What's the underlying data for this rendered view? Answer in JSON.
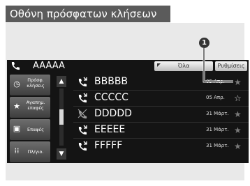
{
  "title": "Οθόνη πρόσφατων κλήσεων",
  "topbar": {
    "contact": "AAAAA",
    "all_label": "Όλα",
    "settings_label": "Ρυθμίσεις"
  },
  "sidebar": [
    {
      "label": "Πρόσφ. κλήσεις",
      "icon": "clock-icon"
    },
    {
      "label": "Αγαπημ. επαφές",
      "icon": "star-icon"
    },
    {
      "label": "Επαφές",
      "icon": "contacts-icon"
    },
    {
      "label": "Πλ/γιο.",
      "icon": "keypad-icon"
    }
  ],
  "calls": [
    {
      "name": "BBBBB",
      "date": "05 Απρ.",
      "type": "incoming"
    },
    {
      "name": "CCCCC",
      "date": "05 Απρ.",
      "type": "incoming"
    },
    {
      "name": "DDDDD",
      "date": "31 Μάρτ.",
      "type": "missed"
    },
    {
      "name": "EEEEE",
      "date": "31 Μάρτ.",
      "type": "incoming"
    },
    {
      "name": "FFFFF",
      "date": "31 Μάρτ.",
      "type": "incoming"
    }
  ],
  "scroll": {
    "up": "▲",
    "down": "▼"
  },
  "callout": "1",
  "colors": {
    "screen_bg": "#141414",
    "title_bg": "#5b5b5b",
    "panel_bg": "#e9e9e9"
  }
}
